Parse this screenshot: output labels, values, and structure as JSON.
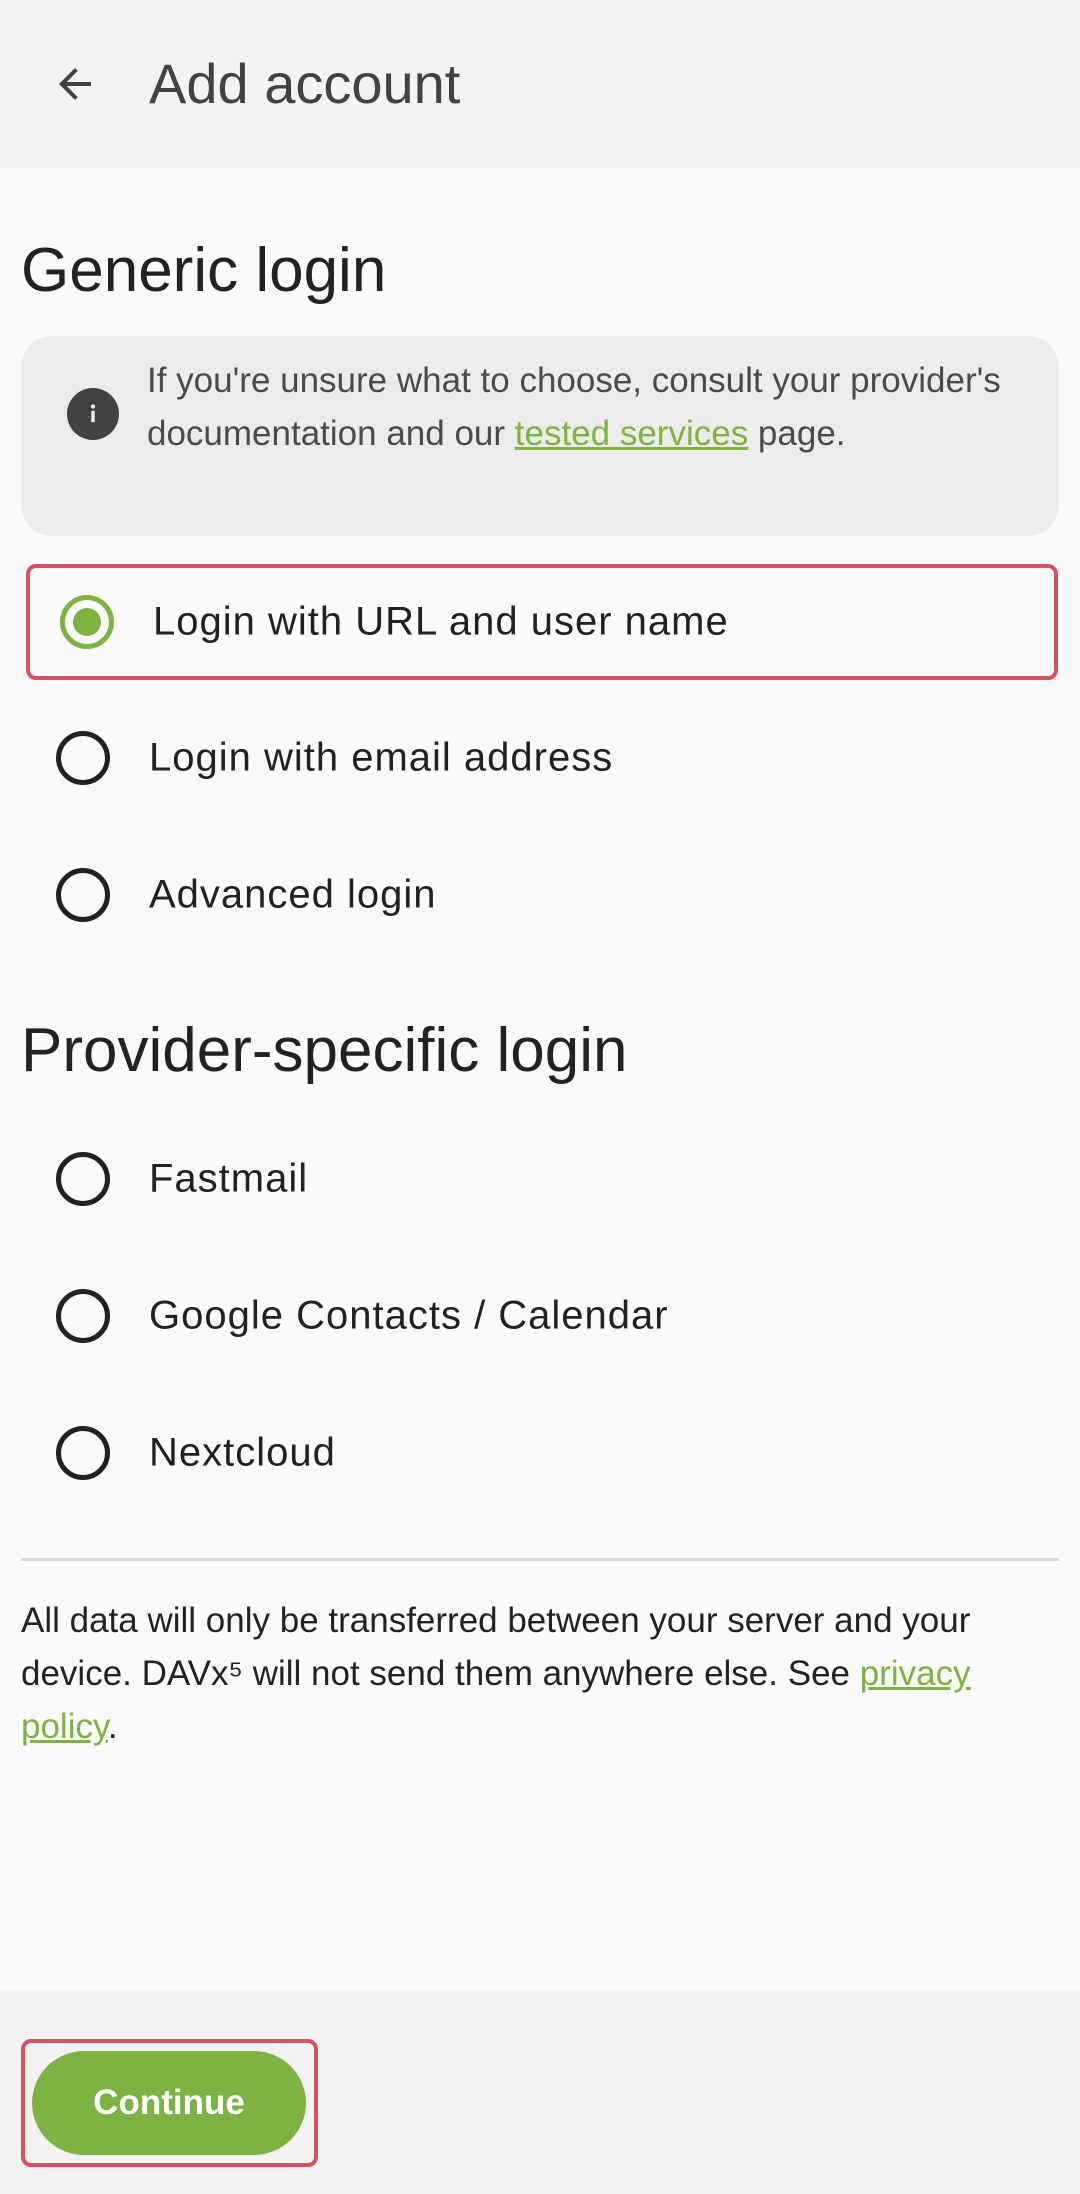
{
  "appbar": {
    "title": "Add account",
    "back_icon": "arrow-back-icon"
  },
  "generic": {
    "heading": "Generic login",
    "info": {
      "icon": "info-icon",
      "text_before": "If you're unsure what to choose, consult your provider's documentation and our ",
      "link": "tested services",
      "text_after": " page."
    },
    "options": [
      {
        "label": "Login with URL and user name",
        "checked": true
      },
      {
        "label": "Login with email address",
        "checked": false
      },
      {
        "label": "Advanced login",
        "checked": false
      }
    ]
  },
  "provider": {
    "heading": "Provider-specific login",
    "options": [
      {
        "label": "Fastmail",
        "checked": false
      },
      {
        "label": "Google Contacts / Calendar",
        "checked": false
      },
      {
        "label": "Nextcloud",
        "checked": false
      }
    ]
  },
  "footer": {
    "text_before": "All data will only be transferred between your server and your device. DAVx⁵ will not send them anywhere else. See ",
    "link": "privacy policy",
    "text_after": "."
  },
  "bottom": {
    "continue_label": "Continue"
  },
  "colors": {
    "accent": "#7cb342",
    "highlight_border": "#d9505e"
  }
}
